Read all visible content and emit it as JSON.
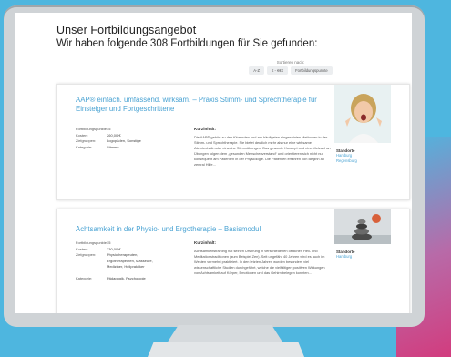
{
  "page": {
    "title": "Unser Fortbildungsangebot",
    "subtitle": "Wir haben folgende 308 Fortbildungen für Sie gefunden:"
  },
  "sort": {
    "label": "Sortieren nach:",
    "options": [
      "A-Z",
      "€ - €€€",
      "Fortbildungspunkte"
    ]
  },
  "courses": [
    {
      "title": "AAP® einfach. umfassend. wirksam. – Praxis Stimm- und Sprechtherapie für Einsteiger und Fortgeschrittene",
      "meta": [
        {
          "key": "Fortbildungspunkte:",
          "value": "15"
        },
        {
          "key": "Kosten:",
          "value": "260,00 €"
        },
        {
          "key": "Zielgruppen:",
          "value": "Logopäden, Sonstige"
        },
        {
          "key": "Kategorie:",
          "value": "Stimme"
        }
      ],
      "summary_heading": "Kurzinhalt:",
      "summary": "Die AAP® gehört zu den führenden und am häufigsten eingesetzten Methoden in der Stimm- und Sprechtherapie. Sie bietet deutlich mehr als nur eine wirksame Atemtechnik oder einzelne Stimmübungen. Das gesamte Konzept und eine Vielzahl an Übungen folgen dem „gesunden Menschenverstand“ und orientieren sich nicht nur konsequent am Patienten in der Physiologie. Die Patienten erfahren von Beginn an zentral Hilfe…",
      "location_heading": "Standorte",
      "locations": [
        "Hamburg",
        "Regensburg"
      ]
    },
    {
      "title": "Achtsamkeit in der Physio- und Ergotherapie – Basismodul",
      "meta": [
        {
          "key": "Fortbildungspunkte:",
          "value": "15"
        },
        {
          "key": "Kosten:",
          "value": "230,00 €"
        },
        {
          "key": "Zielgruppen:",
          "value": "Physiotherapeuten, Ergotherapeuten, Masseure, Mediziner, Heilpraktiker"
        },
        {
          "key": "Kategorie:",
          "value": "Pädagogik, Psychologie"
        }
      ],
      "summary_heading": "Kurzinhalt:",
      "summary": "Achtsamkeitstraining hat seinen Ursprung in verschiedenen östlichen Heil- und Meditationstraditionen (zum Beispiel Zen). Seit ungefähr 40 Jahren wird es auch im Westen vermehrt praktiziert. In den letzten Jahren wurden besonders viel wissenschaftliche Studien durchgeführt, welche die vielfältigen positiven Wirkungen von Achtsamkeit auf Körper, Emotionen und das Gehirn belegen konnten…",
      "location_heading": "Standorte",
      "locations": [
        "Hamburg"
      ]
    }
  ]
}
